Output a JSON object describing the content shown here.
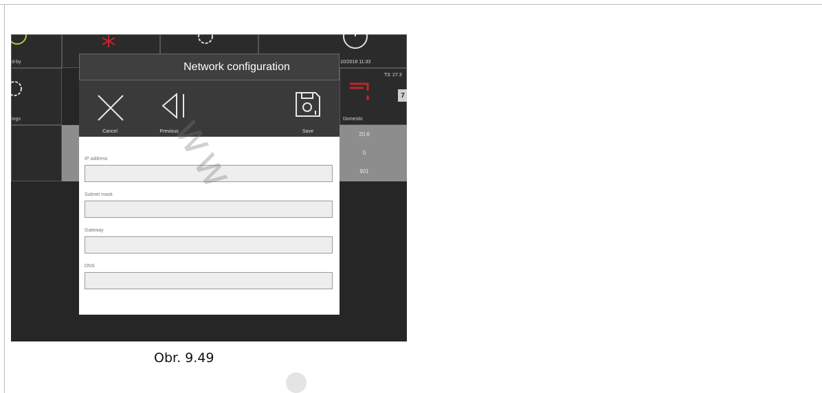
{
  "background_tiles": {
    "standby_label": "d-by",
    "settings_label": "ings",
    "datetime": "10/2018 11:33",
    "temp_label": "T3: 27.3",
    "calendar_digit": "7",
    "domestic_label": "Domestic",
    "values": [
      "20.6",
      "0",
      "901"
    ]
  },
  "dialog": {
    "title": "Network configuration",
    "toolbar": {
      "cancel_label": "Cancel",
      "previous_label": "Previous",
      "save_label": "Save"
    },
    "fields": [
      {
        "label": "IP address",
        "value": ""
      },
      {
        "label": "Subnet mask",
        "value": ""
      },
      {
        "label": "Gateway",
        "value": ""
      },
      {
        "label": "DNS",
        "value": ""
      }
    ]
  },
  "watermark": "ww",
  "caption": "Obr. 9.49",
  "colors": {
    "screen_bg": "#262626",
    "accent_red": "#c0262d",
    "dialog_header": "#3f3f3f"
  },
  "icons": [
    "snowflake-icon",
    "gear-icon",
    "clock-icon",
    "cancel-x-icon",
    "previous-icon",
    "save-floppy-icon",
    "faucet-icon",
    "calendar-icon"
  ]
}
